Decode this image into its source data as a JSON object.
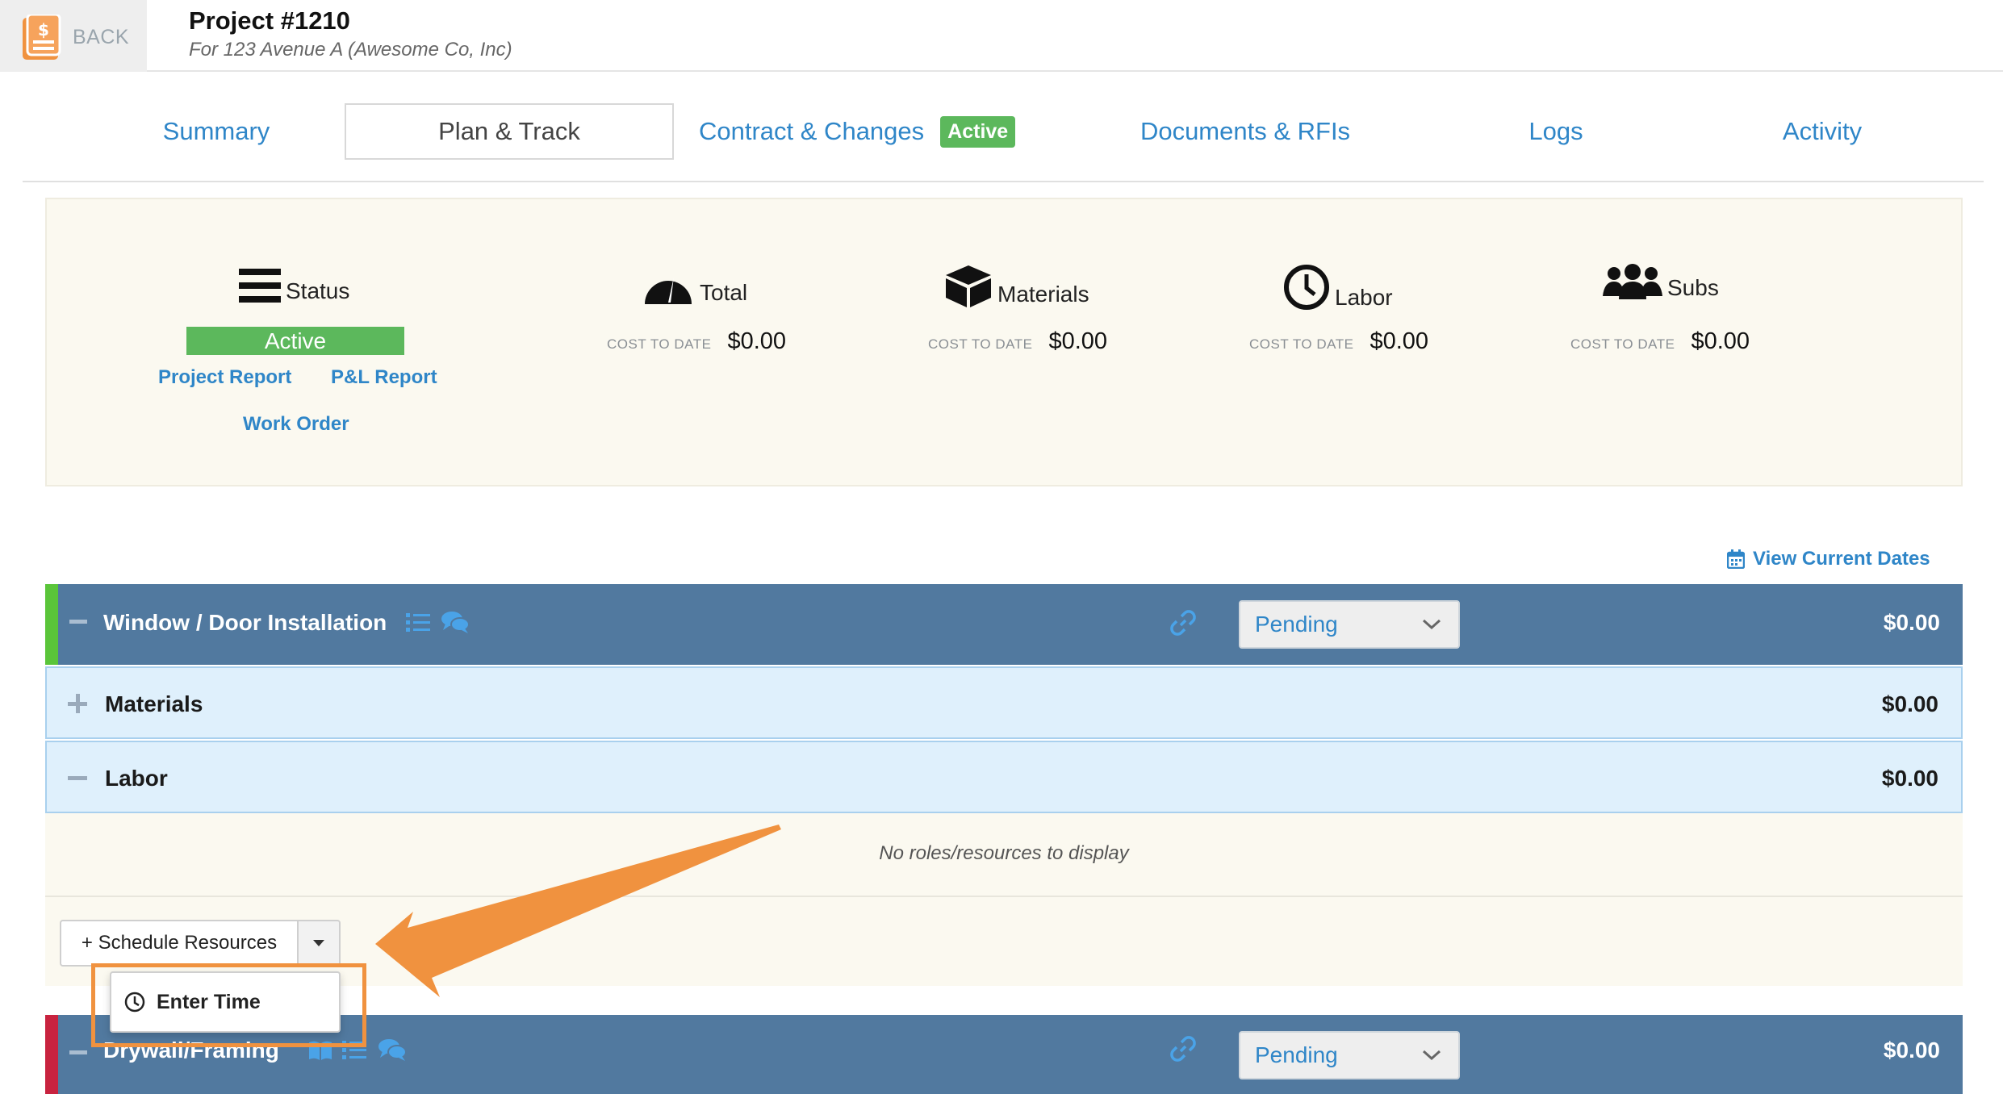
{
  "header": {
    "back_label": "BACK",
    "project_title": "Project #1210",
    "project_subtitle": "For 123 Avenue A (Awesome Co, Inc)"
  },
  "tabs": [
    {
      "label": "Summary",
      "selected": false
    },
    {
      "label": "Plan & Track",
      "selected": true
    },
    {
      "label": "Contract & Changes",
      "selected": false,
      "badge": "Active"
    },
    {
      "label": "Documents & RFIs",
      "selected": false
    },
    {
      "label": "Logs",
      "selected": false
    },
    {
      "label": "Activity",
      "selected": false
    }
  ],
  "summary": {
    "status": {
      "label": "Status",
      "value": "Active",
      "icon": "menu-icon"
    },
    "links": {
      "project_report": "Project Report",
      "pl_report": "P&L Report",
      "work_order": "Work Order"
    },
    "stats": [
      {
        "label": "Total",
        "icon": "gauge-icon",
        "caption": "COST TO DATE",
        "value": "$0.00"
      },
      {
        "label": "Materials",
        "icon": "box-icon",
        "caption": "COST TO DATE",
        "value": "$0.00"
      },
      {
        "label": "Labor",
        "icon": "clock-icon",
        "caption": "COST TO DATE",
        "value": "$0.00"
      },
      {
        "label": "Subs",
        "icon": "users-icon",
        "caption": "COST TO DATE",
        "value": "$0.00"
      }
    ]
  },
  "view_dates_label": "View Current Dates",
  "phases": [
    {
      "name": "Window / Door Installation",
      "status": "Pending",
      "amount": "$0.00",
      "stripe_color": "#5ac53a",
      "subrows": [
        {
          "name": "Materials",
          "amount": "$0.00",
          "expanded": false
        },
        {
          "name": "Labor",
          "amount": "$0.00",
          "expanded": true
        }
      ],
      "empty_message": "No roles/resources to display",
      "schedule_button": "+ Schedule Resources",
      "dropdown_item": "Enter Time"
    },
    {
      "name": "Drywall/Framing",
      "status": "Pending",
      "amount": "$0.00",
      "stripe_color": "#c8233f"
    }
  ],
  "colors": {
    "accent_blue": "#2f86c8",
    "active_green": "#5cb85c",
    "phase_header": "#51799f",
    "highlight_orange": "#f0923f"
  }
}
